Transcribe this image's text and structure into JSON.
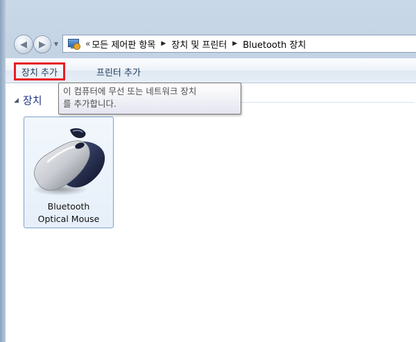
{
  "breadcrumb": {
    "overflow_glyph": "«",
    "items": [
      "모든 제어판 항목",
      "장치 및 프린터",
      "Bluetooth 장치"
    ],
    "separator_glyph": "▶"
  },
  "toolbar": {
    "add_device_label": "장치 추가",
    "add_printer_label": "프린터 추가"
  },
  "tooltip": {
    "line1": "이 컴퓨터에 무선 또는 네트워크 장치",
    "line2": "를 추가합니다."
  },
  "group": {
    "toggle_glyph": "◢",
    "label": "장치"
  },
  "devices": [
    {
      "line1": "Bluetooth",
      "line2": "Optical Mouse",
      "icon": "mouse-icon"
    }
  ],
  "colors": {
    "highlight_border": "#e81c24",
    "group_header": "#1e3287",
    "toolbar_text": "#1e395b"
  }
}
